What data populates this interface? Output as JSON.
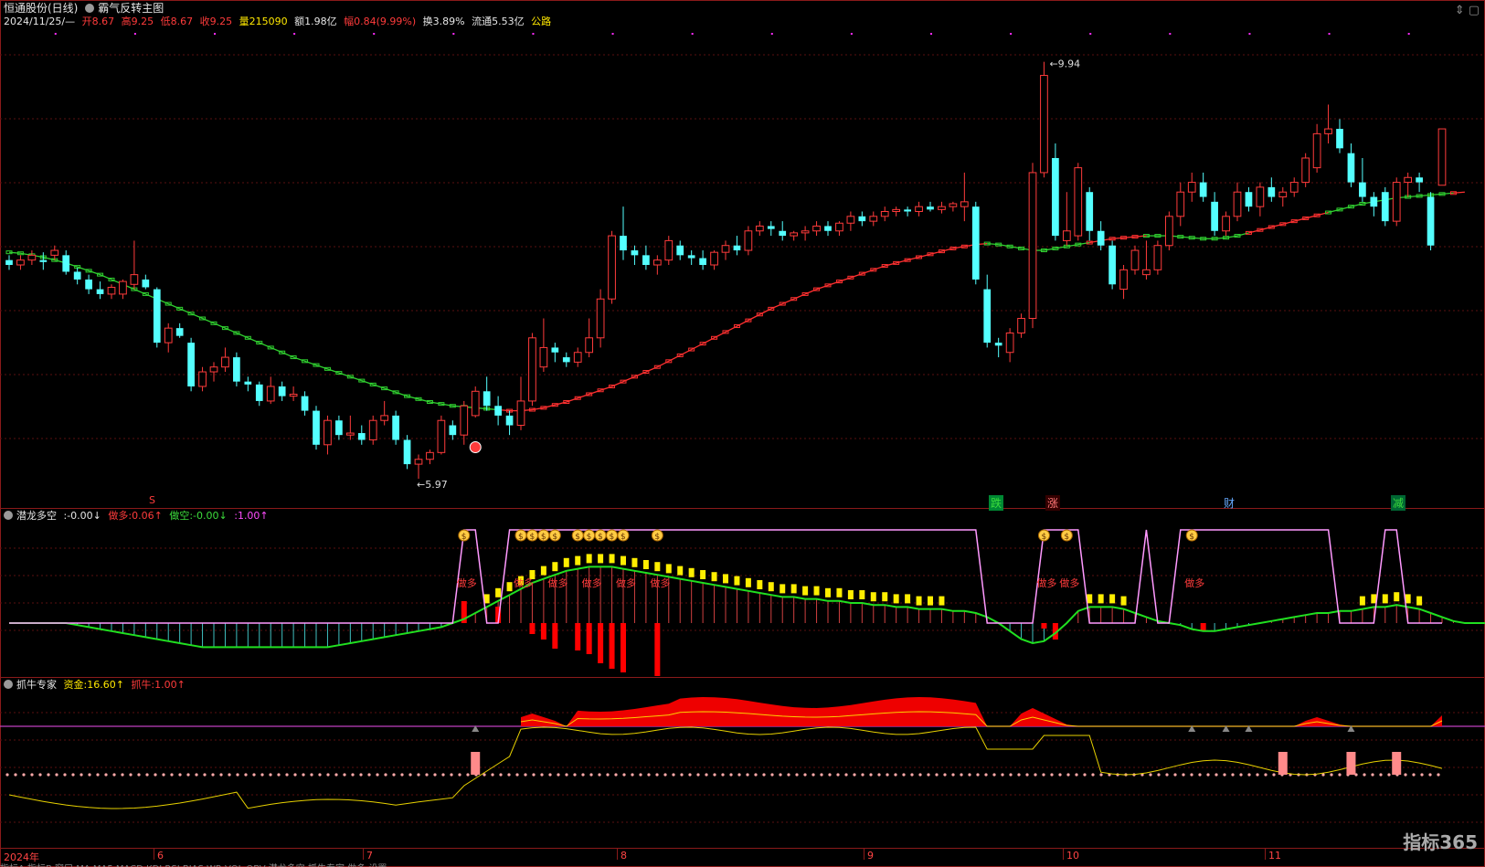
{
  "main_header": {
    "stock": "恒通股份(日线)",
    "indicator": "霸气反转主图",
    "date": "2024/11/25/—",
    "open_label": "开",
    "open": "8.67",
    "high_label": "高",
    "high": "9.25",
    "low_label": "低",
    "low": "8.67",
    "close_label": "收",
    "close": "9.25",
    "vol_label": "量",
    "vol": "215090",
    "amt_label": "额",
    "amt": "1.98亿",
    "chg_label": "幅",
    "chg": "0.84(9.99%)",
    "turn_label": "换",
    "turn": "3.89%",
    "float_label": "流通",
    "float": "5.53亿",
    "sector": "公路"
  },
  "pane2_header": {
    "name": "潜龙多空",
    "v1": ":-0.00↓",
    "v2_label": "做多:",
    "v2": "0.06↑",
    "v3_label": "做空:",
    "v3": "-0.00↓",
    "v4": ":1.00↑"
  },
  "pane3_header": {
    "name": "抓牛专家",
    "v1_label": "资金:",
    "v1": "16.60↑",
    "v2_label": "抓牛:",
    "v2": "1.00↑"
  },
  "annotations": {
    "high_price": "9.94",
    "low_price": "5.97",
    "bull_text": "做多",
    "events": [
      "跌",
      "涨",
      "财",
      "减"
    ],
    "s_marker": "S",
    "money_icon": "$"
  },
  "x_axis": [
    "2024年",
    "6",
    "7",
    "8",
    "9",
    "10",
    "11"
  ],
  "tabs_text": "指标A  指标B  窗口  MA  MA5  MACD  KDJ  RSI  BIAS  WR  VOL  OBV  潜龙多空  抓牛专家  做多  设置",
  "watermark": "指标365",
  "colors": {
    "up": "#ff3b3b",
    "down": "#54ffff",
    "ma_red": "#ff3030",
    "ma_green": "#30d030",
    "bg": "#000000",
    "grid": "#5a0f0f"
  },
  "chart_data": {
    "type": "candlestick",
    "x_ticks": [
      "2024年",
      "6",
      "7",
      "8",
      "9",
      "10",
      "11"
    ],
    "price_range": [
      5.5,
      10.2
    ],
    "candles": [
      [
        7.9,
        7.95,
        7.8,
        7.85
      ],
      [
        7.85,
        7.95,
        7.8,
        7.9
      ],
      [
        7.9,
        8.0,
        7.85,
        7.95
      ],
      [
        7.9,
        7.98,
        7.8,
        7.88
      ],
      [
        7.95,
        8.05,
        7.9,
        8.0
      ],
      [
        7.95,
        8.0,
        7.75,
        7.78
      ],
      [
        7.78,
        7.82,
        7.65,
        7.7
      ],
      [
        7.7,
        7.75,
        7.55,
        7.6
      ],
      [
        7.6,
        7.68,
        7.5,
        7.55
      ],
      [
        7.55,
        7.65,
        7.5,
        7.62
      ],
      [
        7.55,
        7.7,
        7.5,
        7.68
      ],
      [
        7.65,
        8.1,
        7.6,
        7.75
      ],
      [
        7.7,
        7.75,
        7.6,
        7.62
      ],
      [
        7.6,
        7.62,
        7.0,
        7.05
      ],
      [
        7.05,
        7.25,
        6.95,
        7.2
      ],
      [
        7.2,
        7.25,
        7.1,
        7.12
      ],
      [
        7.05,
        7.1,
        6.55,
        6.6
      ],
      [
        6.6,
        6.8,
        6.55,
        6.75
      ],
      [
        6.75,
        6.85,
        6.65,
        6.8
      ],
      [
        6.8,
        7.0,
        6.75,
        6.9
      ],
      [
        6.9,
        6.95,
        6.6,
        6.65
      ],
      [
        6.65,
        6.7,
        6.55,
        6.62
      ],
      [
        6.62,
        6.65,
        6.4,
        6.45
      ],
      [
        6.45,
        6.7,
        6.42,
        6.6
      ],
      [
        6.6,
        6.65,
        6.45,
        6.5
      ],
      [
        6.5,
        6.6,
        6.45,
        6.52
      ],
      [
        6.5,
        6.55,
        6.3,
        6.35
      ],
      [
        6.35,
        6.4,
        5.95,
        6.0
      ],
      [
        6.0,
        6.3,
        5.9,
        6.25
      ],
      [
        6.25,
        6.3,
        6.05,
        6.1
      ],
      [
        6.1,
        6.3,
        6.05,
        6.12
      ],
      [
        6.12,
        6.2,
        6.0,
        6.05
      ],
      [
        6.05,
        6.3,
        6.0,
        6.25
      ],
      [
        6.25,
        6.45,
        6.2,
        6.3
      ],
      [
        6.3,
        6.35,
        6.0,
        6.05
      ],
      [
        6.05,
        6.1,
        5.75,
        5.8
      ],
      [
        5.8,
        5.9,
        5.65,
        5.85
      ],
      [
        5.85,
        5.95,
        5.8,
        5.92
      ],
      [
        5.92,
        6.3,
        5.9,
        6.25
      ],
      [
        6.2,
        6.25,
        6.05,
        6.1
      ],
      [
        6.1,
        6.45,
        6.0,
        6.4
      ],
      [
        6.3,
        6.6,
        6.28,
        6.55
      ],
      [
        6.55,
        6.7,
        6.35,
        6.4
      ],
      [
        6.4,
        6.5,
        6.2,
        6.3
      ],
      [
        6.3,
        6.35,
        6.1,
        6.2
      ],
      [
        6.2,
        6.7,
        6.15,
        6.45
      ],
      [
        6.45,
        7.15,
        6.4,
        7.1
      ],
      [
        6.8,
        7.3,
        6.75,
        7.0
      ],
      [
        7.0,
        7.05,
        6.85,
        6.95
      ],
      [
        6.9,
        6.95,
        6.8,
        6.85
      ],
      [
        6.85,
        7.0,
        6.8,
        6.95
      ],
      [
        6.95,
        7.3,
        6.9,
        7.1
      ],
      [
        7.1,
        7.6,
        7.0,
        7.5
      ],
      [
        7.5,
        8.2,
        7.45,
        8.15
      ],
      [
        8.15,
        8.45,
        7.9,
        8.0
      ],
      [
        8.0,
        8.05,
        7.85,
        7.95
      ],
      [
        7.95,
        8.05,
        7.8,
        7.85
      ],
      [
        7.85,
        7.95,
        7.75,
        7.9
      ],
      [
        7.9,
        8.15,
        7.85,
        8.1
      ],
      [
        8.05,
        8.1,
        7.9,
        7.95
      ],
      [
        7.95,
        8.0,
        7.85,
        7.92
      ],
      [
        7.92,
        8.0,
        7.8,
        7.85
      ],
      [
        7.85,
        8.0,
        7.8,
        7.98
      ],
      [
        7.98,
        8.1,
        7.9,
        8.05
      ],
      [
        8.05,
        8.15,
        7.95,
        8.0
      ],
      [
        8.0,
        8.25,
        7.95,
        8.2
      ],
      [
        8.2,
        8.3,
        8.15,
        8.25
      ],
      [
        8.25,
        8.3,
        8.15,
        8.22
      ],
      [
        8.2,
        8.3,
        8.1,
        8.15
      ],
      [
        8.15,
        8.2,
        8.1,
        8.18
      ],
      [
        8.18,
        8.25,
        8.1,
        8.2
      ],
      [
        8.2,
        8.3,
        8.15,
        8.25
      ],
      [
        8.25,
        8.3,
        8.15,
        8.2
      ],
      [
        8.2,
        8.3,
        8.15,
        8.28
      ],
      [
        8.28,
        8.4,
        8.2,
        8.35
      ],
      [
        8.35,
        8.4,
        8.25,
        8.3
      ],
      [
        8.3,
        8.4,
        8.25,
        8.35
      ],
      [
        8.35,
        8.45,
        8.3,
        8.4
      ],
      [
        8.4,
        8.45,
        8.35,
        8.42
      ],
      [
        8.42,
        8.45,
        8.35,
        8.4
      ],
      [
        8.4,
        8.5,
        8.35,
        8.45
      ],
      [
        8.45,
        8.5,
        8.4,
        8.42
      ],
      [
        8.42,
        8.5,
        8.38,
        8.45
      ],
      [
        8.45,
        8.5,
        8.4,
        8.48
      ],
      [
        8.45,
        8.8,
        8.3,
        8.5
      ],
      [
        8.45,
        8.5,
        7.65,
        7.7
      ],
      [
        7.6,
        7.75,
        7.0,
        7.05
      ],
      [
        7.05,
        7.1,
        6.9,
        7.02
      ],
      [
        6.95,
        7.2,
        6.85,
        7.15
      ],
      [
        7.15,
        7.35,
        7.1,
        7.3
      ],
      [
        7.3,
        8.9,
        7.2,
        8.8
      ],
      [
        8.8,
        9.94,
        8.75,
        9.8
      ],
      [
        8.95,
        9.1,
        8.1,
        8.15
      ],
      [
        8.1,
        8.6,
        8.05,
        8.2
      ],
      [
        8.15,
        8.9,
        8.1,
        8.85
      ],
      [
        8.6,
        8.65,
        8.1,
        8.2
      ],
      [
        8.2,
        8.3,
        8.0,
        8.05
      ],
      [
        8.05,
        8.1,
        7.6,
        7.65
      ],
      [
        7.6,
        7.85,
        7.5,
        7.8
      ],
      [
        7.8,
        8.05,
        7.75,
        8.0
      ],
      [
        7.75,
        8.1,
        7.7,
        7.8
      ],
      [
        7.8,
        8.1,
        7.75,
        8.05
      ],
      [
        8.05,
        8.4,
        8.0,
        8.35
      ],
      [
        8.35,
        8.7,
        8.25,
        8.6
      ],
      [
        8.6,
        8.8,
        8.5,
        8.7
      ],
      [
        8.7,
        8.8,
        8.5,
        8.55
      ],
      [
        8.5,
        8.6,
        8.15,
        8.2
      ],
      [
        8.2,
        8.4,
        8.15,
        8.35
      ],
      [
        8.35,
        8.7,
        8.3,
        8.6
      ],
      [
        8.6,
        8.65,
        8.4,
        8.45
      ],
      [
        8.45,
        8.7,
        8.35,
        8.65
      ],
      [
        8.65,
        8.75,
        8.5,
        8.55
      ],
      [
        8.55,
        8.65,
        8.45,
        8.6
      ],
      [
        8.6,
        8.75,
        8.55,
        8.7
      ],
      [
        8.7,
        9.0,
        8.65,
        8.95
      ],
      [
        8.85,
        9.3,
        8.8,
        9.2
      ],
      [
        9.2,
        9.5,
        9.1,
        9.25
      ],
      [
        9.25,
        9.35,
        9.0,
        9.05
      ],
      [
        9.0,
        9.1,
        8.65,
        8.7
      ],
      [
        8.7,
        8.95,
        8.5,
        8.55
      ],
      [
        8.55,
        8.6,
        8.35,
        8.45
      ],
      [
        8.6,
        8.65,
        8.25,
        8.3
      ],
      [
        8.3,
        8.75,
        8.25,
        8.7
      ],
      [
        8.7,
        8.8,
        8.55,
        8.75
      ],
      [
        8.75,
        8.8,
        8.6,
        8.7
      ],
      [
        8.55,
        8.6,
        8.0,
        8.05
      ],
      [
        8.67,
        9.25,
        8.67,
        9.25
      ]
    ],
    "ma_levels": [
      7.98,
      7.97,
      7.95,
      7.93,
      7.9,
      7.87,
      7.83,
      7.79,
      7.75,
      7.7,
      7.65,
      7.6,
      7.55,
      7.5,
      7.45,
      7.4,
      7.35,
      7.3,
      7.25,
      7.2,
      7.15,
      7.1,
      7.05,
      7.0,
      6.95,
      6.9,
      6.86,
      6.82,
      6.78,
      6.74,
      6.7,
      6.66,
      6.62,
      6.58,
      6.54,
      6.5,
      6.47,
      6.44,
      6.42,
      6.4,
      6.39,
      6.38,
      6.37,
      6.36,
      6.35,
      6.35,
      6.36,
      6.38,
      6.41,
      6.44,
      6.48,
      6.52,
      6.56,
      6.6,
      6.65,
      6.7,
      6.75,
      6.8,
      6.86,
      6.92,
      6.98,
      7.04,
      7.1,
      7.16,
      7.22,
      7.28,
      7.34,
      7.4,
      7.45,
      7.5,
      7.55,
      7.6,
      7.64,
      7.68,
      7.72,
      7.76,
      7.8,
      7.84,
      7.87,
      7.9,
      7.93,
      7.96,
      7.99,
      8.02,
      8.04,
      8.06,
      8.07,
      8.06,
      8.04,
      8.02,
      8.0,
      8.0,
      8.02,
      8.04,
      8.06,
      8.08,
      8.1,
      8.12,
      8.13,
      8.14,
      8.15,
      8.15,
      8.15,
      8.14,
      8.13,
      8.12,
      8.12,
      8.13,
      8.15,
      8.18,
      8.21,
      8.24,
      8.27,
      8.3,
      8.33,
      8.36,
      8.39,
      8.42,
      8.45,
      8.48,
      8.5,
      8.52,
      8.54,
      8.55,
      8.56,
      8.57,
      8.58,
      8.59,
      8.6
    ],
    "ma_green_ranges": [
      [
        0,
        42
      ],
      [
        86,
        94
      ],
      [
        100,
        108
      ],
      [
        116,
        126
      ]
    ],
    "qianlong": {
      "lines": [
        "做多",
        "做空"
      ],
      "green_line": [
        0.0,
        0.0,
        0.0,
        0.0,
        0.0,
        0.0,
        -0.01,
        -0.02,
        -0.03,
        -0.04,
        -0.05,
        -0.06,
        -0.07,
        -0.08,
        -0.09,
        -0.1,
        -0.11,
        -0.12,
        -0.12,
        -0.12,
        -0.12,
        -0.12,
        -0.12,
        -0.12,
        -0.12,
        -0.12,
        -0.12,
        -0.12,
        -0.12,
        -0.11,
        -0.1,
        -0.09,
        -0.08,
        -0.07,
        -0.06,
        -0.05,
        -0.04,
        -0.03,
        -0.02,
        0.0,
        0.02,
        0.05,
        0.08,
        0.11,
        0.14,
        0.17,
        0.2,
        0.22,
        0.24,
        0.26,
        0.27,
        0.28,
        0.28,
        0.28,
        0.27,
        0.26,
        0.25,
        0.24,
        0.23,
        0.22,
        0.21,
        0.2,
        0.19,
        0.18,
        0.17,
        0.16,
        0.15,
        0.14,
        0.13,
        0.13,
        0.12,
        0.12,
        0.11,
        0.11,
        0.1,
        0.1,
        0.09,
        0.09,
        0.08,
        0.08,
        0.07,
        0.07,
        0.07,
        0.06,
        0.06,
        0.05,
        0.03,
        0.0,
        -0.04,
        -0.08,
        -0.1,
        -0.09,
        -0.05,
        0.0,
        0.06,
        0.08,
        0.08,
        0.08,
        0.07,
        0.05,
        0.03,
        0.01,
        0.0,
        -0.01,
        -0.03,
        -0.04,
        -0.04,
        -0.03,
        -0.02,
        -0.01,
        0.0,
        0.01,
        0.02,
        0.03,
        0.04,
        0.05,
        0.05,
        0.06,
        0.06,
        0.07,
        0.08,
        0.08,
        0.09,
        0.08,
        0.07,
        0.05,
        0.03,
        0.01,
        0.0,
        0.0,
        0.0,
        0.0,
        0.01
      ]
    },
    "zhuaniu": {
      "series": [
        "资金",
        "抓牛"
      ],
      "fund_level": 16.6,
      "bull": 1.0
    }
  }
}
